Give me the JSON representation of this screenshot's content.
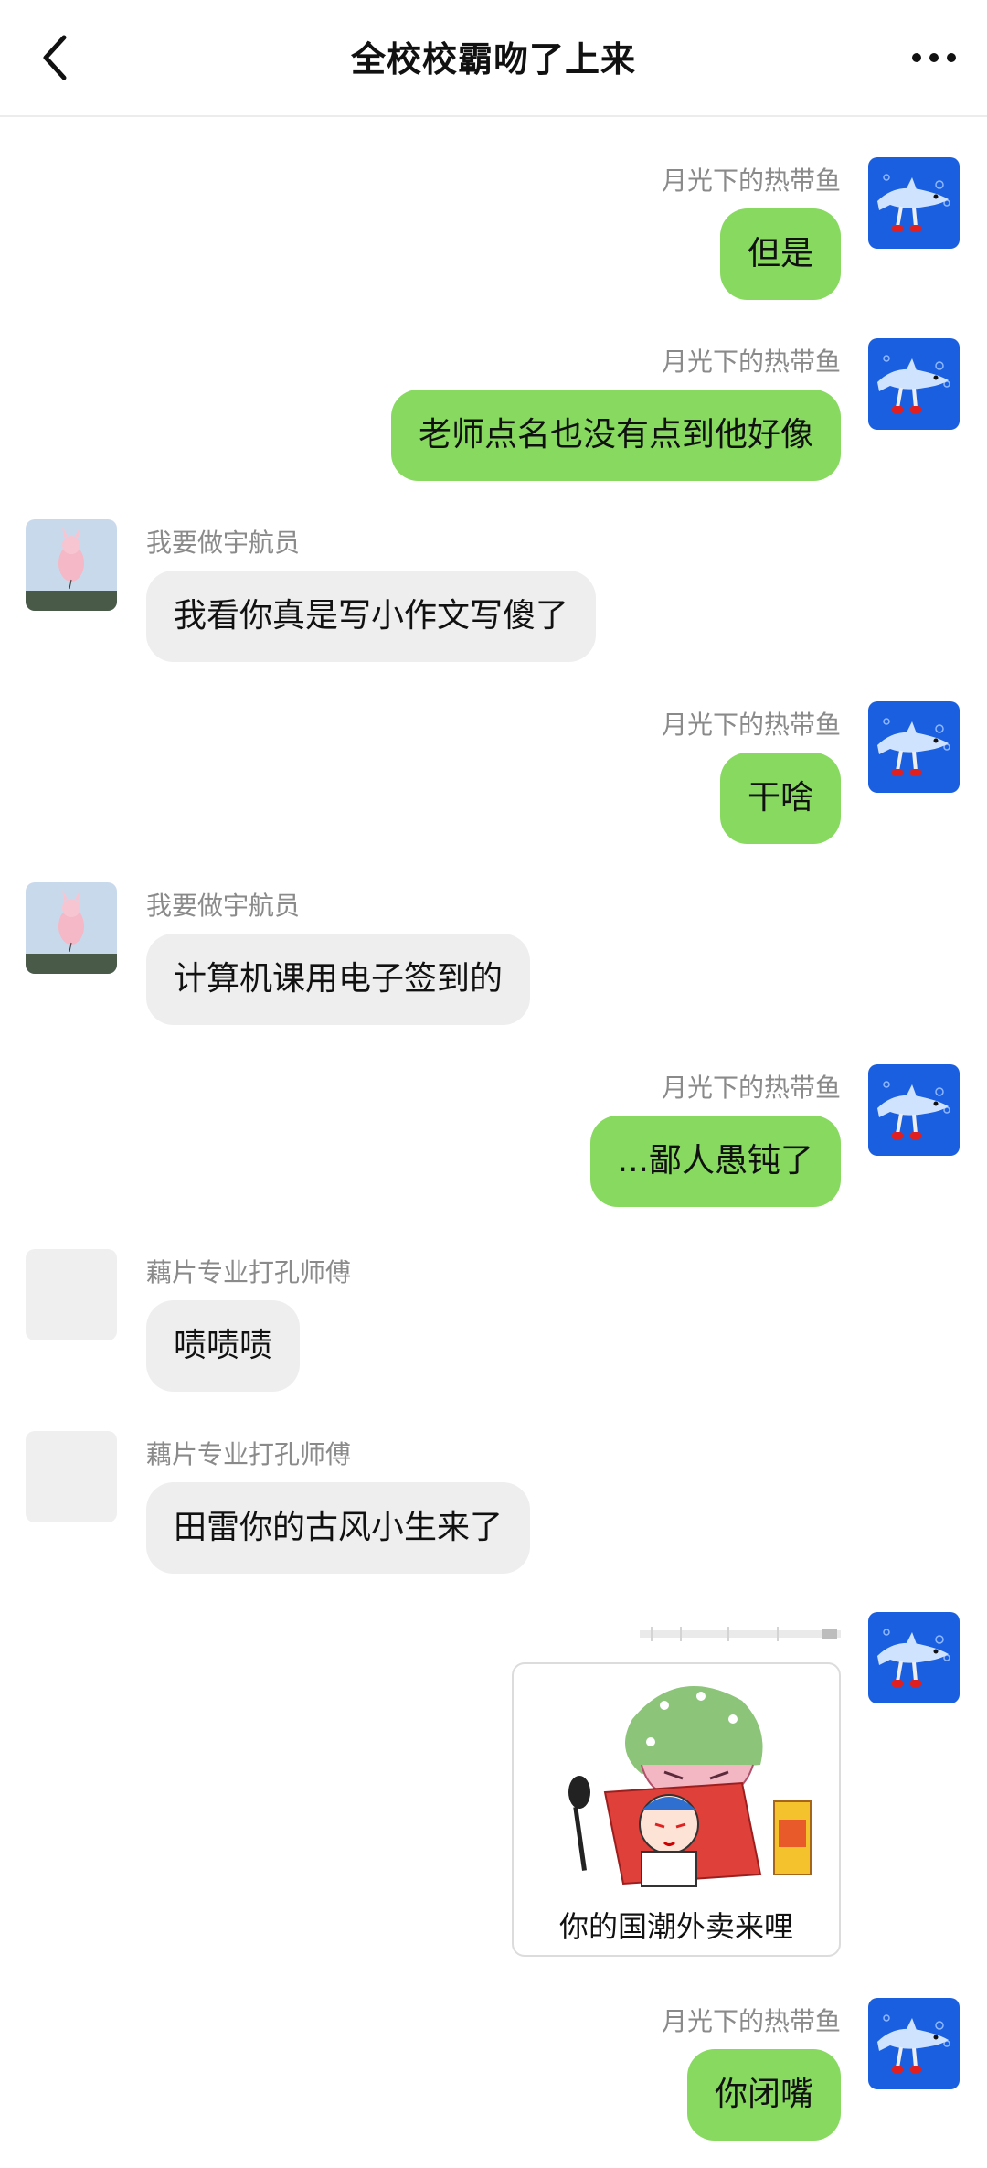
{
  "header": {
    "title": "全校校霸吻了上来",
    "back_icon": "chevron-left-icon",
    "more_icon": "more-horizontal-icon"
  },
  "colors": {
    "self_bubble": "#87d960",
    "other_bubble": "#eeeeee",
    "name_text": "#8a8a8a",
    "self_avatar_bg": "#1a5fe0"
  },
  "messages": [
    {
      "side": "right",
      "sender": "月光下的热带鱼",
      "text": "但是"
    },
    {
      "side": "right",
      "sender": "月光下的热带鱼",
      "text": "老师点名也没有点到他好像"
    },
    {
      "side": "left",
      "sender": "我要做宇航员",
      "text": "我看你真是写小作文写傻了"
    },
    {
      "side": "right",
      "sender": "月光下的热带鱼",
      "text": "干啥"
    },
    {
      "side": "left",
      "sender": "我要做宇航员",
      "text": "计算机课用电子签到的"
    },
    {
      "side": "right",
      "sender": "月光下的热带鱼",
      "text": "...鄙人愚钝了"
    },
    {
      "side": "left",
      "sender": "藕片专业打孔师傅",
      "text": "啧啧啧"
    },
    {
      "side": "left",
      "sender": "藕片专业打孔师傅",
      "text": "田雷你的古风小生来了"
    },
    {
      "side": "right",
      "sender": "",
      "sticker_caption": "你的国潮外卖来哩"
    },
    {
      "side": "right",
      "sender": "月光下的热带鱼",
      "text": "你闭嘴"
    }
  ]
}
